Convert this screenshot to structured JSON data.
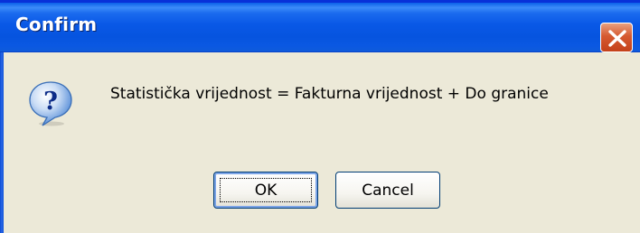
{
  "dialog": {
    "title": "Confirm",
    "message": "Statistička vrijednost = Fakturna vrijednost + Do granice",
    "icon": "question-icon",
    "buttons": {
      "ok_label": "OK",
      "cancel_label": "Cancel"
    },
    "default_button": "OK"
  },
  "colors": {
    "titlebar": "#0A5FE8",
    "close_button": "#D65A31",
    "dialog_background": "#ECE9D8",
    "icon_bubble": "#4F88D6"
  }
}
